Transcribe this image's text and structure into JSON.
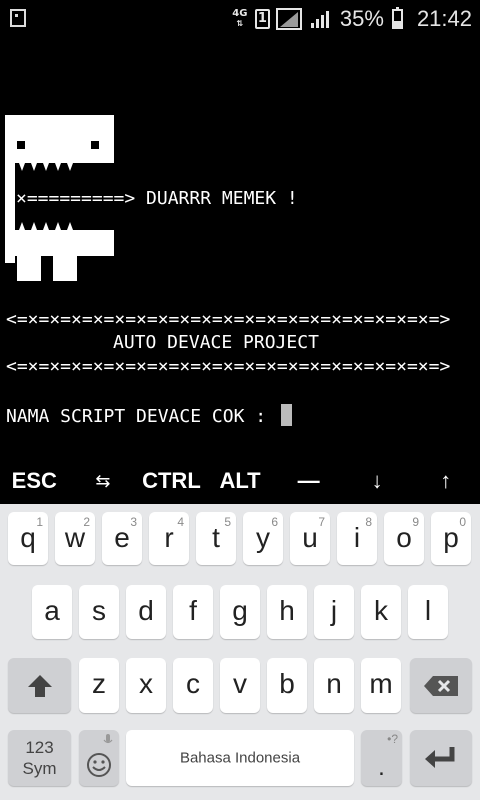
{
  "status_bar": {
    "network": "4G",
    "sim": "1",
    "battery": "35%",
    "time": "21:42"
  },
  "terminal": {
    "tagline": "×=========> DUARRR MEMEK !",
    "separator": "<=×=×=×=×=×=×=×=×=×=×=×=×=×=×=×=×=×=×=×=>",
    "project_title": "AUTO DEVACE PROJECT",
    "prompt": "NAMA SCRIPT DEVACE COK : "
  },
  "extra_keys": [
    "ESC",
    "⇆",
    "CTRL",
    "ALT",
    "—",
    "↓",
    "↑"
  ],
  "keyboard": {
    "row1": [
      {
        "key": "q",
        "hint": "1"
      },
      {
        "key": "w",
        "hint": "2"
      },
      {
        "key": "e",
        "hint": "3"
      },
      {
        "key": "r",
        "hint": "4"
      },
      {
        "key": "t",
        "hint": "5"
      },
      {
        "key": "y",
        "hint": "6"
      },
      {
        "key": "u",
        "hint": "7"
      },
      {
        "key": "i",
        "hint": "8"
      },
      {
        "key": "o",
        "hint": "9"
      },
      {
        "key": "p",
        "hint": "0"
      }
    ],
    "row2": [
      "a",
      "s",
      "d",
      "f",
      "g",
      "h",
      "j",
      "k",
      "l"
    ],
    "row3": [
      "z",
      "x",
      "c",
      "v",
      "b",
      "n",
      "m"
    ],
    "sym_label_top": "123",
    "sym_label_bottom": "Sym",
    "space_label": "Bahasa Indonesia",
    "period": ".",
    "period_hint": "•?"
  }
}
